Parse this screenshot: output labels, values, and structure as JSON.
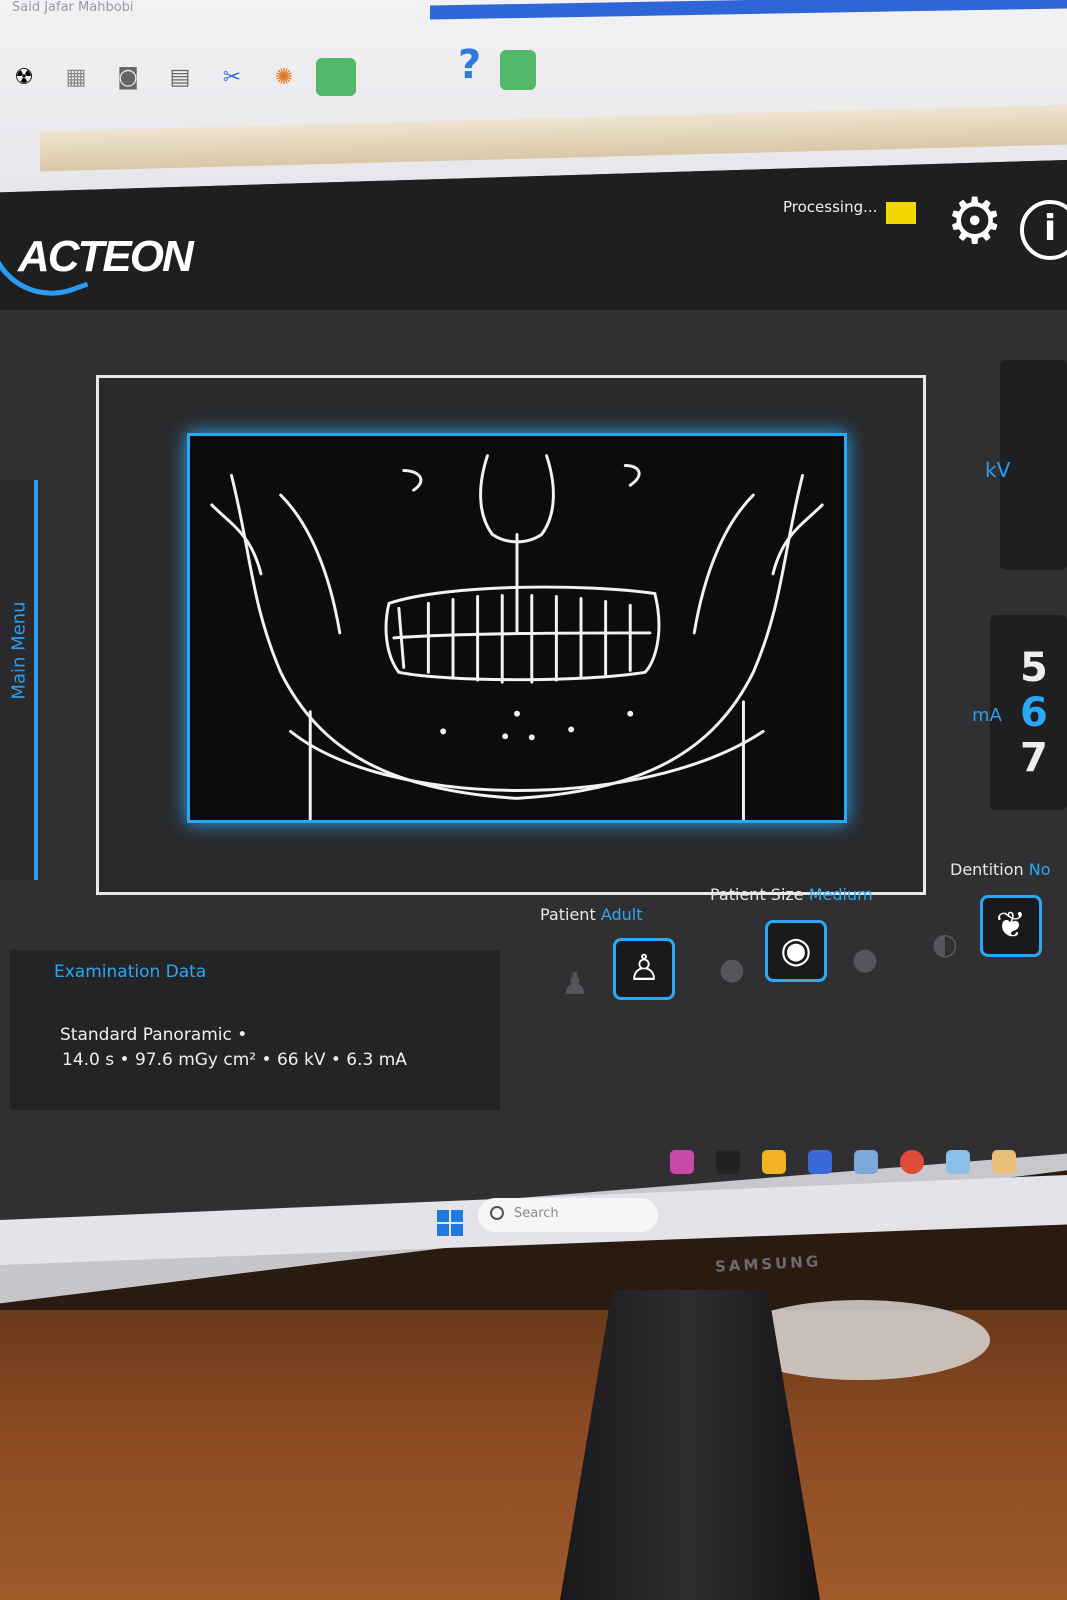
{
  "top_app": {
    "user_name": "Said Jafar Mahbobi",
    "help_glyph": "?"
  },
  "header": {
    "logo": "ACTEON",
    "status": "Processing...",
    "status_color": "#f2d800",
    "settings_icon": "gear-icon",
    "info_icon": "info-icon"
  },
  "side_menu": {
    "label": "Main Menu"
  },
  "right_panel": {
    "kv_label": "kV",
    "ma_label": "mA",
    "ma_values": [
      "5",
      "6",
      "7"
    ]
  },
  "exam": {
    "title": "Examination Data",
    "line1": "Standard Panoramic •",
    "line2": "14.0 s • 97.6 mGy cm² • 66 kV • 6.3 mA"
  },
  "options": {
    "patient_label": "Patient",
    "patient_value": "Adult",
    "size_label": "Patient Size",
    "size_value": "Medium",
    "dentition_label": "Dentition",
    "dentition_value": "No"
  },
  "taskbar": {
    "search_placeholder": "Search"
  },
  "monitor": {
    "brand": "SAMSUNG"
  },
  "colors": {
    "accent": "#2aa8f5",
    "background": "#303033",
    "header": "#1f1f21"
  }
}
